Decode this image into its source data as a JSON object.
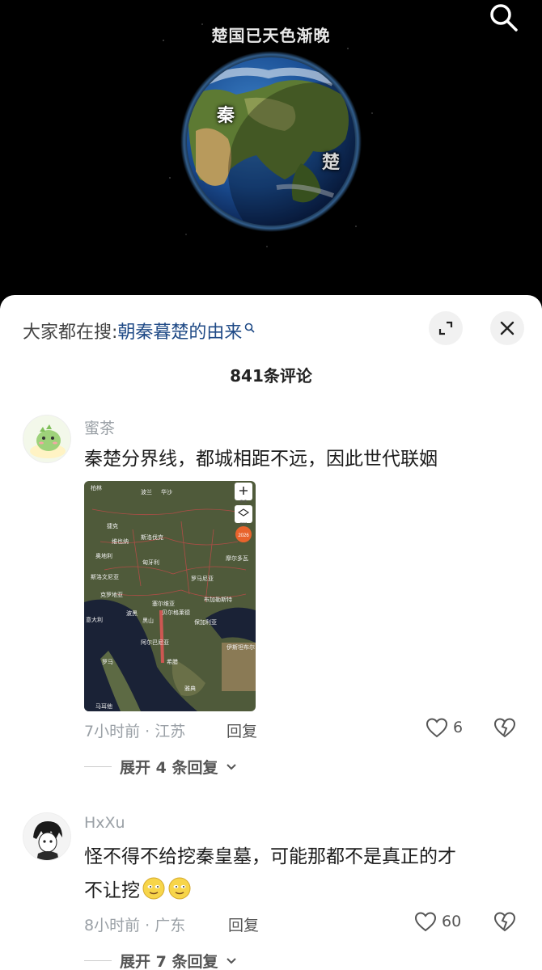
{
  "video": {
    "caption": "楚国已天色渐晚",
    "label_qin": "秦",
    "label_chu": "楚"
  },
  "sheet": {
    "search_prefix": "大家都在搜:",
    "search_term": "朝秦暮楚的由来",
    "comment_count": "841条评论"
  },
  "comments": [
    {
      "user": "蜜茶",
      "text": "秦楚分界线，都城相距不远，因此世代联姻",
      "time_location": "7小时前 · 江苏",
      "reply_label": "回复",
      "likes": "6",
      "expand_label": "展开 4 条回复",
      "map": {
        "labels": [
          "柏林",
          "波兰",
          "华沙",
          "捷克",
          "维也纳",
          "斯洛伐克",
          "奥地利",
          "匈牙利",
          "斯洛文尼亚",
          "克罗地亚",
          "罗马尼亚",
          "摩尔多瓦",
          "波黑",
          "塞尔维亚",
          "布加勒斯特",
          "意大利",
          "黑山",
          "保加利亚",
          "阿尔巴尼亚",
          "希腊",
          "雅典",
          "伊斯坦布尔",
          "马耳他",
          "罗马",
          "贝尔格莱德"
        ],
        "tool_more": "更多",
        "tool_layers": "图层",
        "tool_badge_year": "2026"
      }
    },
    {
      "user": "HxXu",
      "text_line1": "怪不得不给挖秦皇墓，可能那都不是真正的才",
      "text_line2": "不让挖",
      "time_location": "8小时前 · 广东",
      "reply_label": "回复",
      "likes": "60",
      "expand_label": "展开 7 条回复"
    }
  ],
  "colors": {
    "link": "#1f4a86",
    "muted": "#9aa0a6",
    "sheet_bg": "#ffffff"
  },
  "icons": [
    "search-icon",
    "magnifier-icon",
    "expand-icon",
    "close-icon",
    "heart-icon",
    "broken-heart-icon",
    "chevron-down-icon",
    "plus-icon",
    "layers-icon"
  ]
}
